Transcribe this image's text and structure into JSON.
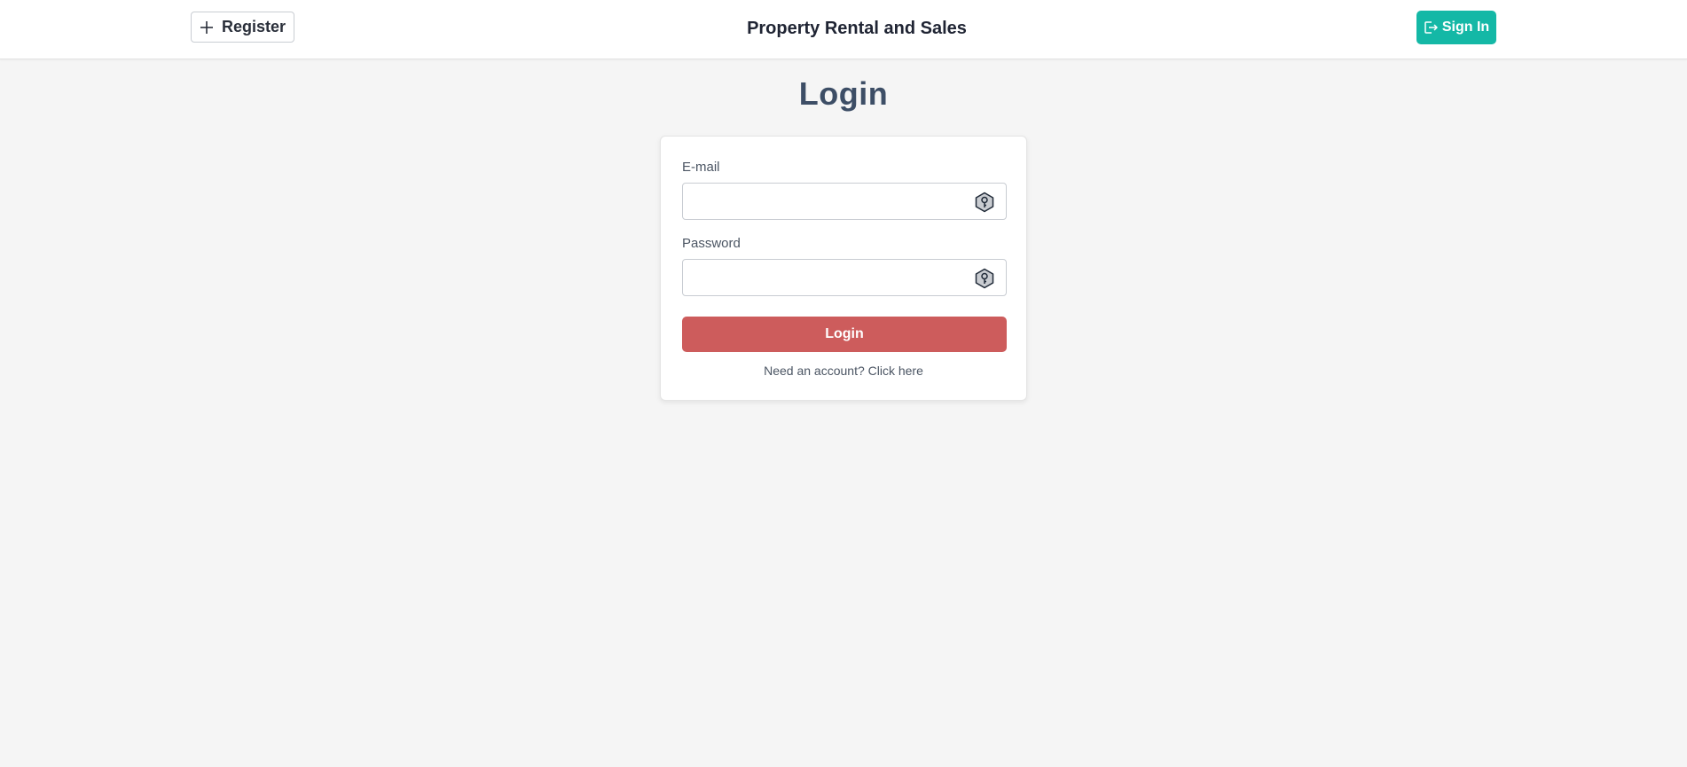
{
  "header": {
    "app_title": "Property Rental and Sales",
    "register_label": "Register",
    "sign_in_label": "Sign In",
    "sign_in_color": "#14b8a6"
  },
  "login_form": {
    "heading": "Login",
    "email": {
      "label": "E-mail",
      "value": "",
      "placeholder": "",
      "icon": "password-manager-key-icon"
    },
    "password": {
      "label": "Password",
      "value": "",
      "placeholder": "",
      "icon": "password-manager-key-icon"
    },
    "submit_label": "Login",
    "submit_color": "#cd5c5c",
    "account_link": "Need an account? Click here"
  }
}
